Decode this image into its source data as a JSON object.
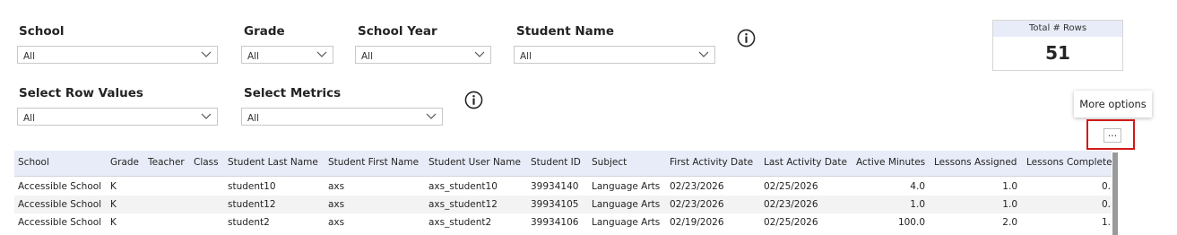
{
  "filters": {
    "school": {
      "label": "School",
      "value": "All"
    },
    "grade": {
      "label": "Grade",
      "value": "All"
    },
    "school_year": {
      "label": "School Year",
      "value": "All"
    },
    "student_name": {
      "label": "Student Name",
      "value": "All"
    },
    "row_values": {
      "label": "Select Row Values",
      "value": "All"
    },
    "metrics": {
      "label": "Select Metrics",
      "value": "All"
    }
  },
  "card": {
    "title": "Total # Rows",
    "value": "51"
  },
  "more_options": {
    "tooltip": "More options",
    "glyph": "..."
  },
  "table": {
    "headers": [
      "School",
      "Grade",
      "Teacher",
      "Class",
      "Student Last Name",
      "Student First Name",
      "Student User Name",
      "Student ID",
      "Subject",
      "First Activity Date",
      "Last Activity Date",
      "Active Minutes",
      "Lessons Assigned",
      "Lessons Complete"
    ],
    "rows": [
      [
        "Accessible School",
        "K",
        "",
        "",
        "student10",
        "axs",
        "axs_student10",
        "39934140",
        "Language Arts",
        "02/23/2026",
        "02/25/2026",
        "4.0",
        "1.0",
        "0."
      ],
      [
        "Accessible School",
        "K",
        "",
        "",
        "student12",
        "axs",
        "axs_student12",
        "39934105",
        "Language Arts",
        "02/23/2026",
        "02/23/2026",
        "1.0",
        "1.0",
        "0."
      ],
      [
        "Accessible School",
        "K",
        "",
        "",
        "student2",
        "axs",
        "axs_student2",
        "39934106",
        "Language Arts",
        "02/19/2026",
        "02/25/2026",
        "100.0",
        "2.0",
        "1."
      ]
    ]
  },
  "colors": {
    "header_bg": "#e7ecf8",
    "highlight_border": "#d11a1a"
  }
}
